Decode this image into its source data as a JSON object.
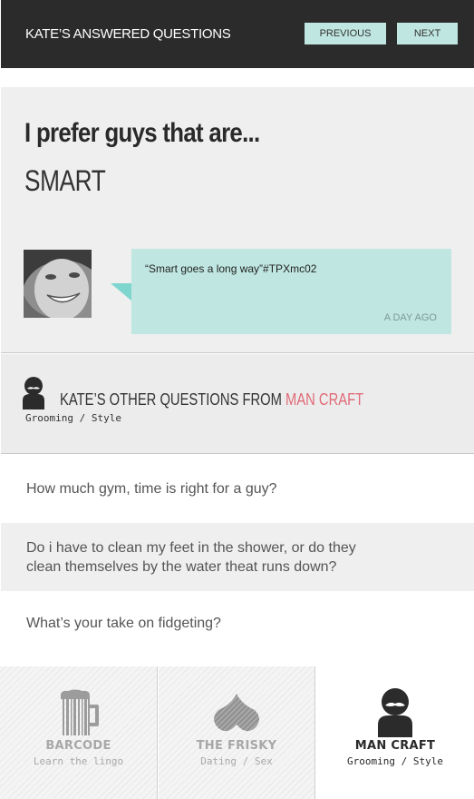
{
  "header": {
    "title": "KATE’S ANSWERED QUESTIONS",
    "prev_label": "PREVIOUS",
    "next_label": "NEXT"
  },
  "answer": {
    "question": "I prefer guys that are...",
    "value": "SMART",
    "comment": "“Smart goes a long way”#TPXmc02",
    "time": "A DAY AGO"
  },
  "other": {
    "title_prefix": "KATE’S OTHER QUESTIONS FROM ",
    "title_accent": "MAN CRAFT",
    "subtitle": "Grooming / Style",
    "questions": [
      "How much gym, time is right for a guy?",
      "Do i have to clean my feet in the shower, or do they clean themselves by the water theat runs down?",
      "What’s your take on fidgeting?"
    ]
  },
  "categories": [
    {
      "name": "BARCODE",
      "desc": "Learn the lingo",
      "icon": "beer-mug-icon"
    },
    {
      "name": "THE FRISKY",
      "desc": "Dating / Sex",
      "icon": "heart-icon"
    },
    {
      "name": "MAN CRAFT",
      "desc": "Grooming / Style",
      "icon": "mustache-man-icon"
    }
  ],
  "colors": {
    "header_bg": "#2b2b2b",
    "button_bg": "#bfe6e0",
    "accent": "#e06b78",
    "bubble": "#bfe6e0"
  }
}
